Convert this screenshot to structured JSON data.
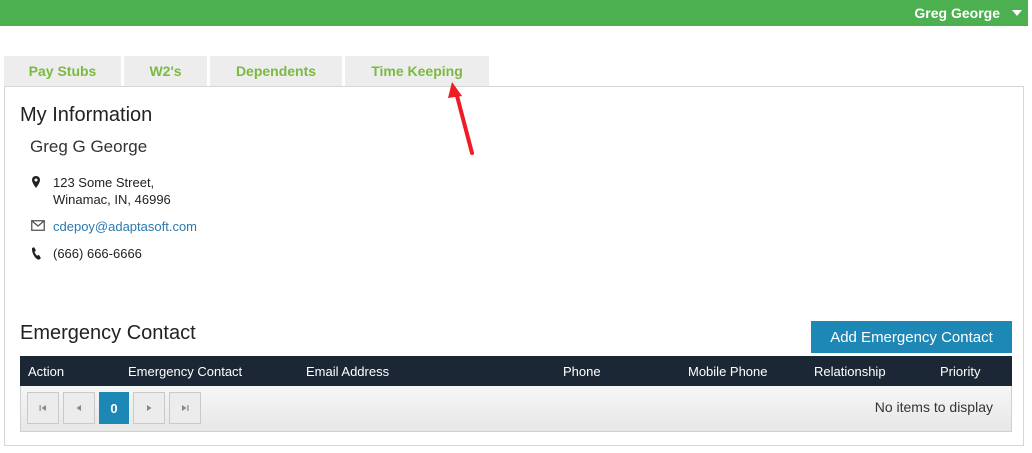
{
  "header": {
    "user_name": "Greg George",
    "bar_color": "#4caf50"
  },
  "tabs": [
    {
      "label": "Pay Stubs"
    },
    {
      "label": "W2's"
    },
    {
      "label": "Dependents"
    },
    {
      "label": "Time Keeping"
    }
  ],
  "my_information": {
    "title": "My Information",
    "name": "Greg G George",
    "address_line1": "123 Some Street,",
    "address_line2": "Winamac, IN, 46996",
    "email": "cdepoy@adaptasoft.com",
    "phone": "(666) 666-6666",
    "icons": [
      "map-marker-icon",
      "envelope-icon",
      "phone-icon"
    ]
  },
  "emergency_contact": {
    "title": "Emergency Contact",
    "add_button_label": "Add Emergency Contact",
    "columns": [
      "Action",
      "Emergency Contact",
      "Email Address",
      "Phone",
      "Mobile Phone",
      "Relationship",
      "Priority"
    ],
    "pager": {
      "current_page": "0",
      "empty_message": "No items to display"
    },
    "accent_color": "#1d87b5",
    "header_color": "#1c2735"
  },
  "annotation": {
    "arrow_color": "#ee1c24",
    "points_to": "Time Keeping"
  }
}
